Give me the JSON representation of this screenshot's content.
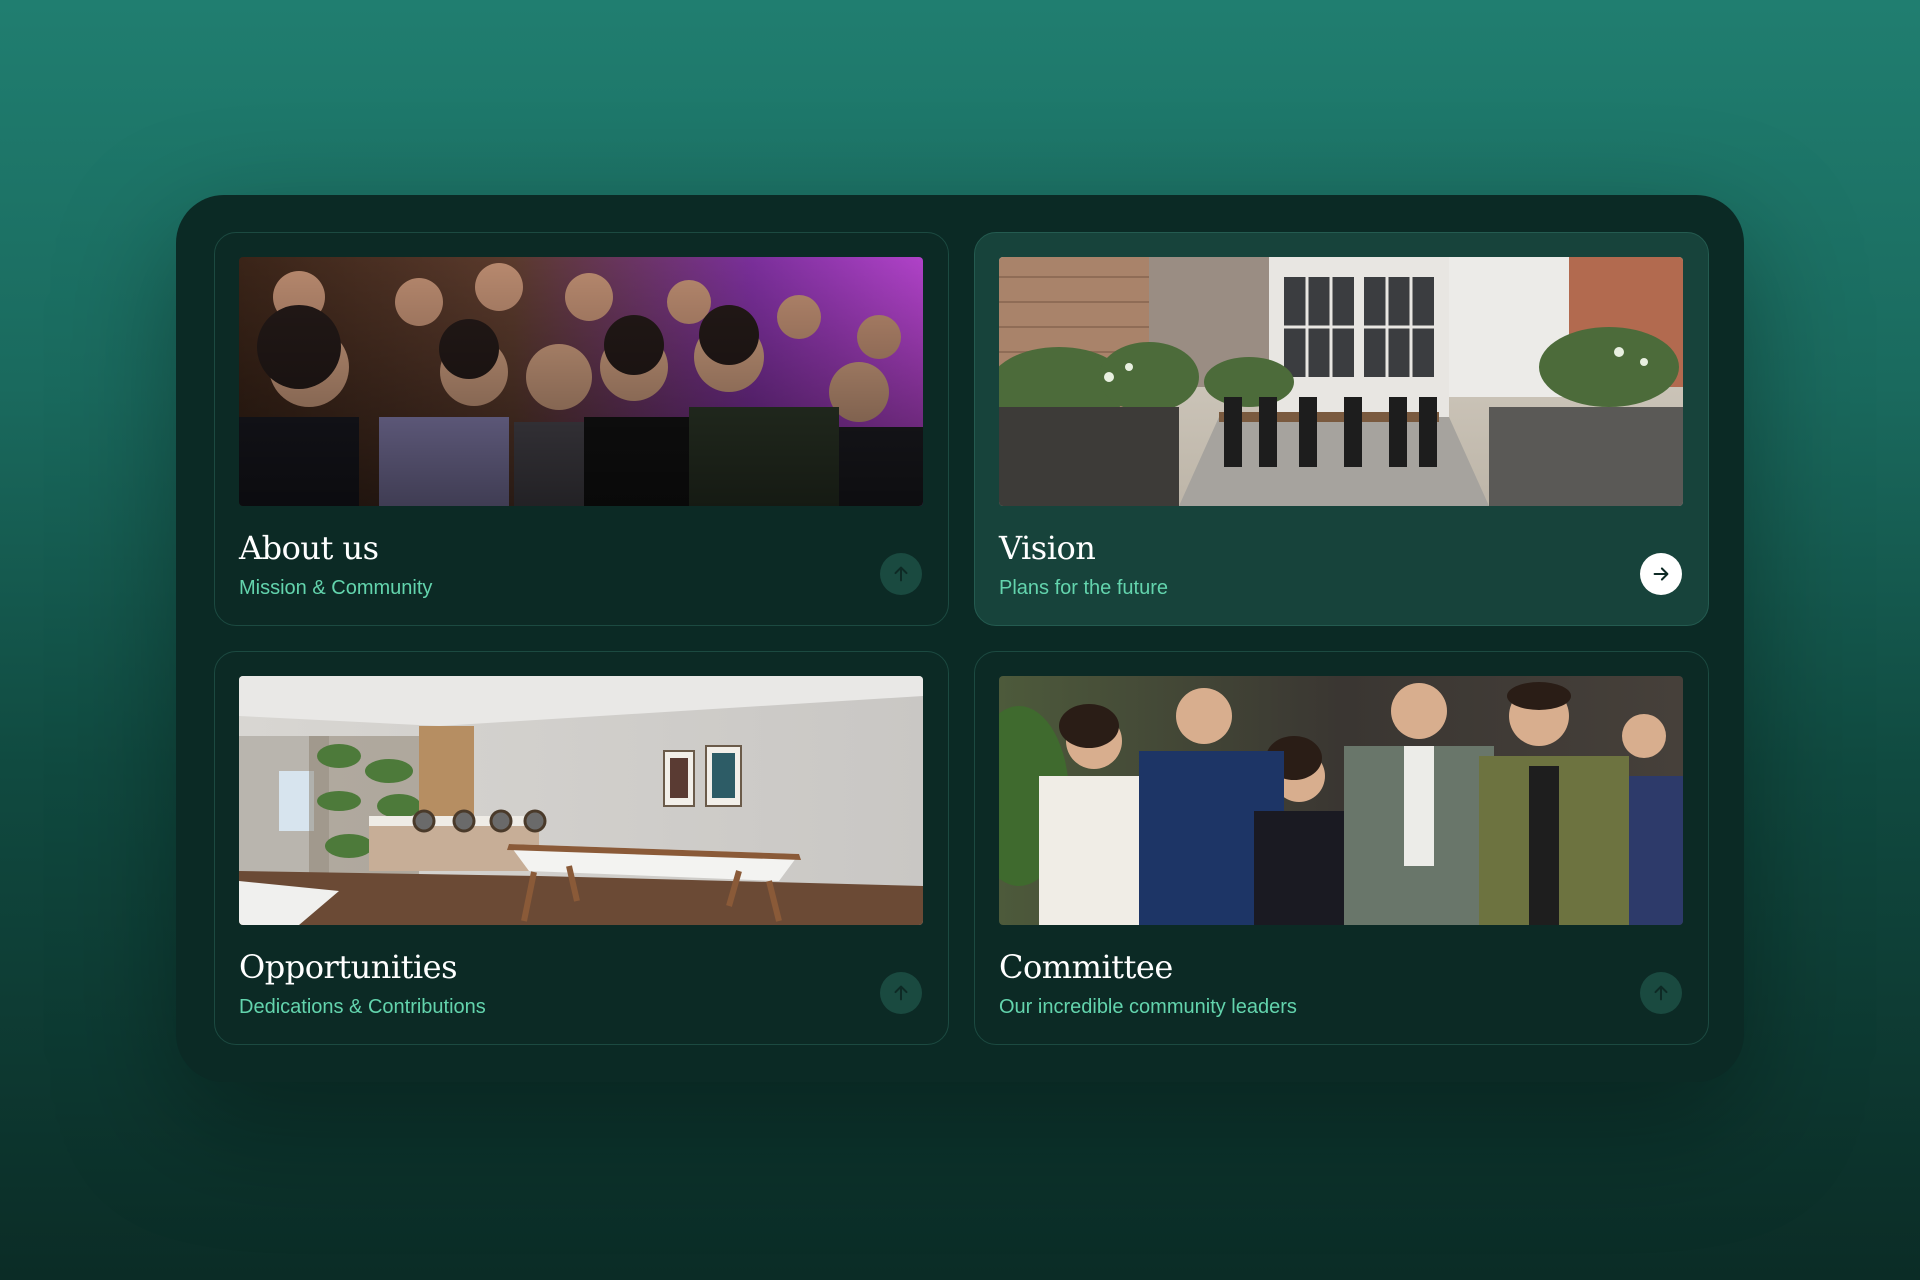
{
  "cards": [
    {
      "title": "About us",
      "subtitle": "Mission & Community",
      "photo": "crowd of young people at an evening party",
      "icon": "arrow-up-icon",
      "active": false
    },
    {
      "title": "Vision",
      "subtitle": "Plans for the future",
      "photo": "rendered courtyard with dining table and plants",
      "icon": "arrow-right-icon",
      "active": true
    },
    {
      "title": "Opportunities",
      "subtitle": "Dedications & Contributions",
      "photo": "rendered lounge room with shuffleboard table",
      "icon": "arrow-up-icon",
      "active": false
    },
    {
      "title": "Committee",
      "subtitle": "Our incredible community leaders",
      "photo": "group of smiling people at an event",
      "icon": "arrow-up-icon",
      "active": false
    }
  ],
  "colors": {
    "panel": "#0b2a25",
    "card_active": "#17433b",
    "accent": "#63d4ad",
    "arrow_inactive": "#1a4a40",
    "arrow_active": "#ffffff"
  }
}
